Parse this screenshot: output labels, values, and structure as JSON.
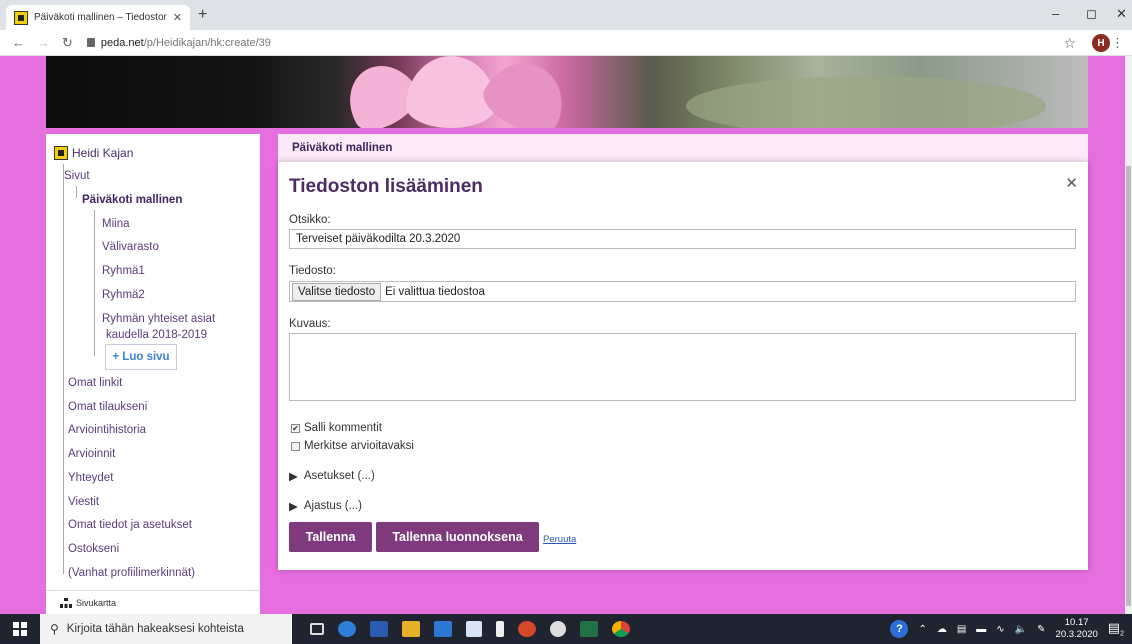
{
  "browser": {
    "tab_title": "Päiväkoti mallinen – Tiedoston li",
    "tab_close": "✕",
    "new_tab": "+",
    "url_host": "peda.net",
    "url_path": "/p/Heidikajan/hk:create/39",
    "avatar_letter": "H"
  },
  "sidebar": {
    "owner": "Heidi Kajan",
    "sivut": "Sivut",
    "current_page": "Päiväkoti mallinen",
    "children": [
      "Miina",
      "Välivarasto",
      "Ryhmä1",
      "Ryhmä2"
    ],
    "multiline_child_1": "Ryhmän yhteiset asiat",
    "multiline_child_2": "kaudella 2018-2019",
    "new_page": "+ Luo sivu",
    "links": [
      "Omat linkit",
      "Omat tilaukseni",
      "Arviointihistoria",
      "Arvioinnit",
      "Yhteydet",
      "Viestit",
      "Omat tiedot ja asetukset",
      "Ostokseni",
      "(Vanhat profiilimerkinnät)"
    ],
    "sitemap": "Sivukartta"
  },
  "main": {
    "breadcrumb_title": "Päiväkoti mallinen",
    "dialog_title": "Tiedoston lisääminen",
    "title_label": "Otsikko:",
    "title_value": "Terveiset päiväkodilta 20.3.2020",
    "file_label": "Tiedosto:",
    "file_button": "Valitse tiedosto",
    "file_status": "Ei valittua tiedostoa",
    "description_label": "Kuvaus:",
    "description_value": "",
    "allow_comments": "Salli kommentit",
    "allow_comments_checked": true,
    "mark_assessable": "Merkitse arvioitavaksi",
    "mark_assessable_checked": false,
    "settings": "Asetukset (...)",
    "scheduling": "Ajastus (...)",
    "save": "Tallenna",
    "save_draft": "Tallenna luonnoksena",
    "cancel": "Peruuta"
  },
  "taskbar": {
    "search_placeholder": "Kirjoita tähän hakeaksesi kohteista",
    "time": "10.17",
    "date": "20.3.2020",
    "notification_count": "2"
  },
  "colors": {
    "page_background": "#e66fe0",
    "accent_button": "#7e3a7c",
    "heading": "#4a2c63",
    "link": "#3c82d8"
  }
}
